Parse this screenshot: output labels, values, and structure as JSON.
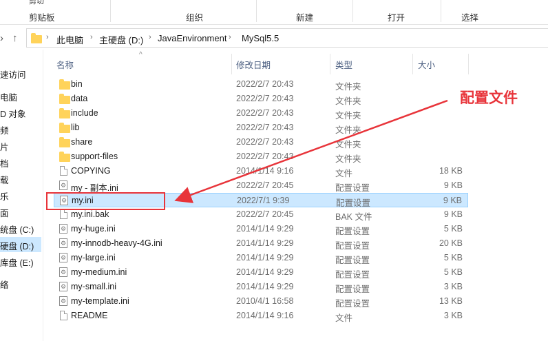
{
  "ribbon": {
    "peek_top": [
      "剪切",
      "",
      "",
      ""
    ],
    "groups": [
      "剪贴板",
      "组织",
      "新建",
      "打开",
      "选择"
    ]
  },
  "address": {
    "crumbs": [
      "此电脑",
      "主硬盘 (D:)",
      "JavaEnvironment",
      "MySql5.5"
    ]
  },
  "nav": {
    "items": [
      "速访问",
      "电脑",
      "D 对象",
      "频",
      "片",
      "档",
      "载",
      "乐",
      "面",
      "统盘 (C:)",
      "硬盘 (D:)",
      "库盘 (E:)",
      "络"
    ]
  },
  "columns": {
    "name": "名称",
    "date": "修改日期",
    "type": "类型",
    "size": "大小"
  },
  "files": [
    {
      "name": "bin",
      "date": "2022/2/7 20:43",
      "type": "文件夹",
      "size": "",
      "kind": "folder"
    },
    {
      "name": "data",
      "date": "2022/2/7 20:43",
      "type": "文件夹",
      "size": "",
      "kind": "folder"
    },
    {
      "name": "include",
      "date": "2022/2/7 20:43",
      "type": "文件夹",
      "size": "",
      "kind": "folder"
    },
    {
      "name": "lib",
      "date": "2022/2/7 20:43",
      "type": "文件夹",
      "size": "",
      "kind": "folder"
    },
    {
      "name": "share",
      "date": "2022/2/7 20:43",
      "type": "文件夹",
      "size": "",
      "kind": "folder"
    },
    {
      "name": "support-files",
      "date": "2022/2/7 20:43",
      "type": "文件夹",
      "size": "",
      "kind": "folder"
    },
    {
      "name": "COPYING",
      "date": "2014/1/14 9:16",
      "type": "文件",
      "size": "18 KB",
      "kind": "file"
    },
    {
      "name": "my - 副本.ini",
      "date": "2022/2/7 20:45",
      "type": "配置设置",
      "size": "9 KB",
      "kind": "ini"
    },
    {
      "name": "my.ini",
      "date": "2022/7/1 9:39",
      "type": "配置设置",
      "size": "9 KB",
      "kind": "ini",
      "selected": true
    },
    {
      "name": "my.ini.bak",
      "date": "2022/2/7 20:45",
      "type": "BAK 文件",
      "size": "9 KB",
      "kind": "file"
    },
    {
      "name": "my-huge.ini",
      "date": "2014/1/14 9:29",
      "type": "配置设置",
      "size": "5 KB",
      "kind": "ini"
    },
    {
      "name": "my-innodb-heavy-4G.ini",
      "date": "2014/1/14 9:29",
      "type": "配置设置",
      "size": "20 KB",
      "kind": "ini"
    },
    {
      "name": "my-large.ini",
      "date": "2014/1/14 9:29",
      "type": "配置设置",
      "size": "5 KB",
      "kind": "ini"
    },
    {
      "name": "my-medium.ini",
      "date": "2014/1/14 9:29",
      "type": "配置设置",
      "size": "5 KB",
      "kind": "ini"
    },
    {
      "name": "my-small.ini",
      "date": "2014/1/14 9:29",
      "type": "配置设置",
      "size": "3 KB",
      "kind": "ini"
    },
    {
      "name": "my-template.ini",
      "date": "2010/4/1 16:58",
      "type": "配置设置",
      "size": "13 KB",
      "kind": "ini"
    },
    {
      "name": "README",
      "date": "2014/1/14 9:16",
      "type": "文件",
      "size": "3 KB",
      "kind": "file"
    }
  ],
  "annotation": {
    "label": "配置文件",
    "color": "#e8343a"
  },
  "colors": {
    "selection_bg": "#cce8ff",
    "folder": "#ffd35a",
    "header_text": "#4d6082"
  }
}
